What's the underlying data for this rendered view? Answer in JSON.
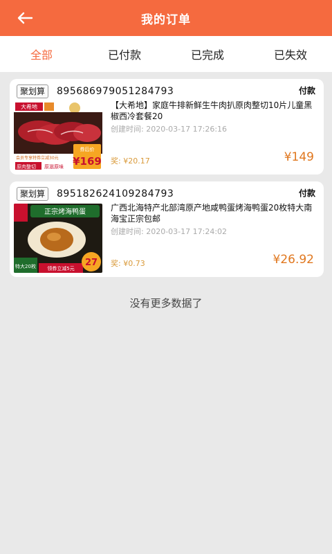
{
  "header": {
    "title": "我的订单"
  },
  "tabs": [
    {
      "label": "全部",
      "active": true
    },
    {
      "label": "已付款",
      "active": false
    },
    {
      "label": "已完成",
      "active": false
    },
    {
      "label": "已失效",
      "active": false
    }
  ],
  "orders": [
    {
      "badge": "聚划算",
      "order_no": "895686979051284793",
      "status": "付款",
      "name": "【大希地】家庭牛排新鲜生牛肉扒原肉整切10片儿童黑椒西冷套餐20",
      "created": "创建时间: 2020-03-17 17:26:16",
      "reward": "奖: ¥20.17",
      "price": "¥149",
      "thumb": {
        "brand": "大希地",
        "tag": "会员专享特券立减30元",
        "coupon": "券后价",
        "price": "¥169",
        "line1": "原肉整切",
        "line2": "原滋原味"
      }
    },
    {
      "badge": "聚划算",
      "order_no": "895182624109284793",
      "status": "付款",
      "name": "广西北海特产北部湾原产地咸鸭蛋烤海鸭蛋20枚特大南海宝正宗包邮",
      "created": "创建时间: 2020-03-17 17:24:02",
      "reward": "奖: ¥0.73",
      "price": "¥26.92",
      "thumb": {
        "title": "正宗烤海鸭蛋",
        "size": "特大20枚",
        "coupon": "领券立减5元",
        "price": "27"
      }
    }
  ],
  "footer": {
    "no_more": "没有更多数据了"
  }
}
